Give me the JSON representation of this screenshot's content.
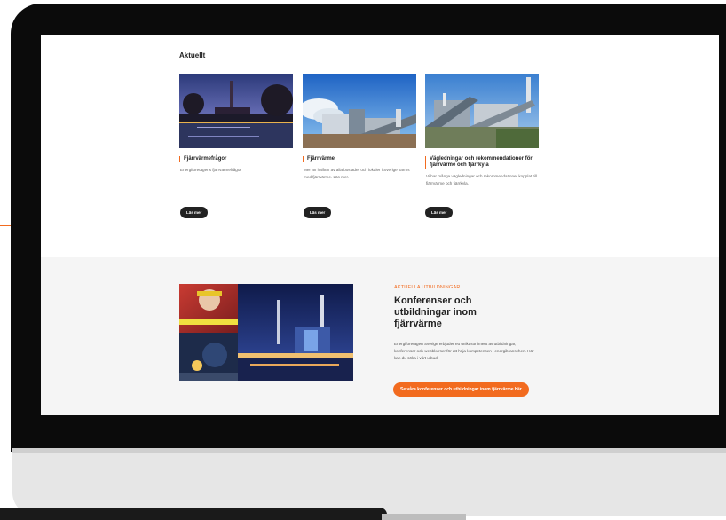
{
  "news": {
    "section_title": "Aktuellt",
    "cards": [
      {
        "title": "Fjärrvärmefrågor",
        "description": "Energiföretagens fjärrvärmefrågor",
        "button": "Läs mer"
      },
      {
        "title": "Fjärrvärme",
        "description": "Mer än hälften av alla bostäder och lokaler i Sverige värms med fjärrvärme. Läs mer.",
        "button": "Läs mer"
      },
      {
        "title": "Vägledningar och rekommendationer för fjärrvärme och fjärrkyla",
        "description": "Vi har många vägledningar och rekommendationer kopplat till fjärrvärme och fjärrkyla.",
        "button": "Läs mer"
      }
    ]
  },
  "education": {
    "eyebrow": "AKTUELLA UTBILDNINGAR",
    "title": "Konferenser och utbildningar inom fjärrvärme",
    "description": "Energiföretagen Sverige erbjuder ett unikt sortiment av utbildningar, konferenser och webbkurser för att höja kompetensen i energibranschen. Här kan du söka i vårt utbud.",
    "button": "Se våra konferenser och utbildningar inom fjärrvärme här"
  },
  "colors": {
    "accent": "#f26b1f",
    "dark": "#222222",
    "section_bg": "#f5f5f5"
  }
}
